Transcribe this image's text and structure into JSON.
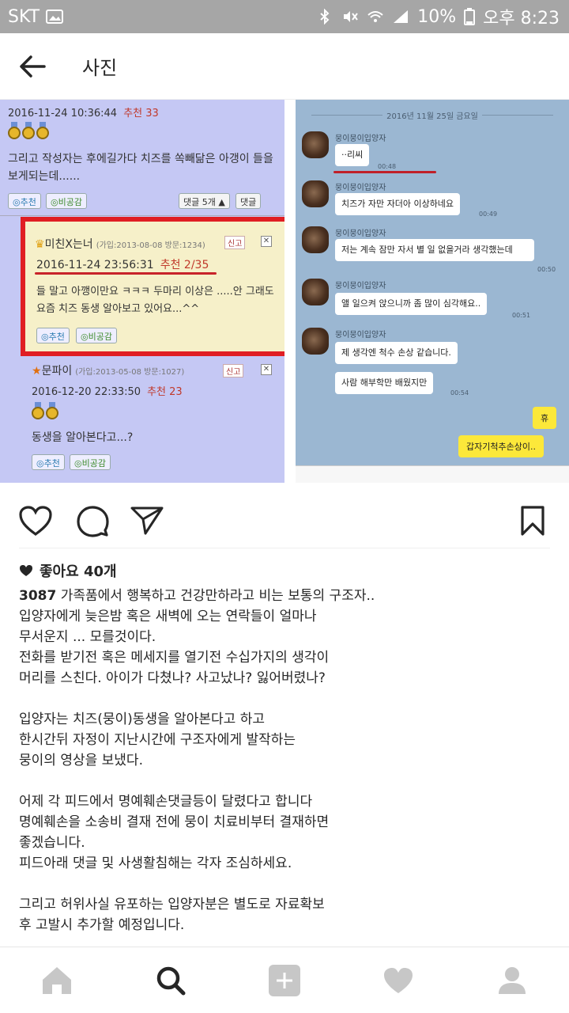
{
  "status_bar": {
    "carrier": "SKT",
    "battery": "10%",
    "time": "오후 8:23"
  },
  "header": {
    "title": "사진"
  },
  "image": {
    "left_panel": {
      "comment1": {
        "date": "2016-11-24 10:36:44",
        "recommend": "추천 33",
        "text": "그리고 작성자는 후에길가다 치즈를 쏙빼닮은 아갱이 들을보게되는데......",
        "btn_recommend": "◎추천",
        "btn_nonpublic": "◎비공감",
        "btn_replies": "댓글 5개 ▲",
        "btn_reply": "댓글"
      },
      "comment2": {
        "name": "미친X는너",
        "meta": "(가입:2013-08-08 방문:1234)",
        "report": "신고",
        "close": "✕",
        "date": "2016-11-24 23:56:31",
        "recommend": "추천 2/35",
        "text": "들 말고 아깽이만요 ㅋㅋㅋ 두마리 이상은 .....안 그래도 요즘 치즈 동생 알아보고 있어요...^^",
        "btn_recommend": "◎추천",
        "btn_nonpublic": "◎비공감"
      },
      "comment3": {
        "name": "문파이",
        "meta": "(가입:2013-05-08 방문:1027)",
        "report": "신고",
        "close": "✕",
        "date": "2016-12-20 22:33:50",
        "recommend": "추천 23",
        "text": "동생을 알아본다고...?",
        "btn_recommend": "◎추천",
        "btn_nonpublic": "◎비공감"
      }
    },
    "right_panel": {
      "date_divider": "2016년 11월 25일 금요일",
      "sender": "뭉이뭉이입양자",
      "messages": [
        {
          "text": "··리씨",
          "time": "00:48"
        },
        {
          "text": "치즈가 자만 자더아 이상하네요",
          "time": "00:49"
        },
        {
          "text": "저는 계속 잠만 자서 별 일 없을거라 생각했는데",
          "time": "00:50"
        },
        {
          "text": "앨 일으켜 앉으니까 좀 많이 심각해요..",
          "time": "00:51"
        },
        {
          "text": "제 생각엔 척수 손상 같습니다.",
          "time": ""
        },
        {
          "text": "사람 해부학만 배웠지만",
          "time": "00:54"
        }
      ],
      "my_messages": [
        "휴",
        "갑자기척추손상이.."
      ]
    }
  },
  "likes": {
    "text": "좋아요 40개"
  },
  "caption": {
    "username": "3087",
    "text": " 가족품에서 행복하고 건강만하라고 비는 보통의 구조자..\n입양자에게 늦은밤 혹은 새벽에 오는 연락들이 얼마나\n무서운지 ... 모를것이다.\n전화를 받기전 혹은 메세지를 열기전 수십가지의 생각이\n머리를 스친다. 아이가 다쳤나? 사고났나? 잃어버렸나?\n\n입양자는 치즈(뭉이)동생을 알아본다고 하고\n한시간뒤 자정이 지난시간에 구조자에게 발작하는\n뭉이의 영상을 보냈다.\n\n어제 각 피드에서 명예훼손댓글등이 달렸다고 합니다\n명예훼손을 소송비 결재 전에 뭉이 치료비부터 결재하면\n좋겠습니다.\n피드아래 댓글 및 사생활침해는 각자 조심하세요.\n\n그리고 허위사실 유포하는 입양자분은 별도로 자료확보\n후 고발시 추가할 예정입니다."
  },
  "colors": {
    "status_bar": "#a6a6a6",
    "highlight_red": "#e01e23",
    "chat_yellow": "#fce83a",
    "chat_bg": "#9bb7d2",
    "comments_bg": "#c5c8f4"
  }
}
